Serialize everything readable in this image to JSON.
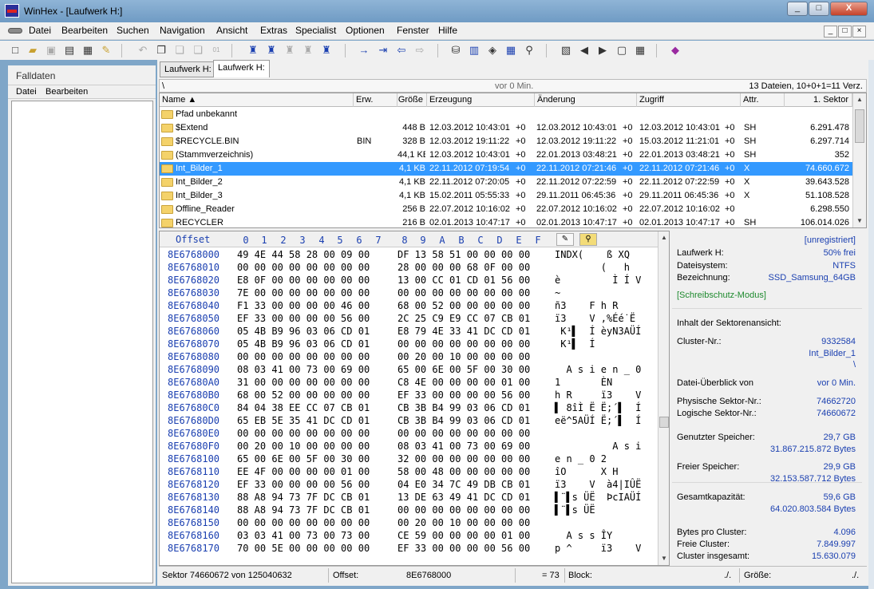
{
  "window": {
    "title": "WinHex - [Laufwerk H:]",
    "caption_buttons": [
      "_",
      "□",
      "X"
    ]
  },
  "menu": {
    "items": [
      "Datei",
      "Bearbeiten",
      "Suchen",
      "Navigation",
      "Ansicht",
      "Extras",
      "Specialist",
      "Optionen",
      "Fenster",
      "Hilfe"
    ],
    "mdi_buttons": [
      "_",
      "□",
      "×"
    ]
  },
  "toolbar": {
    "icons": [
      "new-file-icon",
      "open-icon",
      "save-icon",
      "print-icon",
      "properties-icon",
      "edit-icon",
      "undo-icon",
      "copy-icon",
      "paste-icon",
      "write-icon",
      "find-text-icon",
      "find-hex-icon",
      "replace-text-icon",
      "replace-hex-icon",
      "find-combined-icon",
      "goto-offset-icon",
      "goto-sector-icon",
      "back-icon",
      "forward-icon",
      "open-disk-icon",
      "clone-icon",
      "image-icon",
      "calculator-icon",
      "analyze-icon",
      "directory-browser-icon",
      "prev-icon",
      "next-icon",
      "snapshot-icon",
      "grid-icon",
      "help-book-icon"
    ]
  },
  "case_pane": {
    "title": "Falldaten",
    "menu": [
      "Datei",
      "Bearbeiten"
    ]
  },
  "tabs": [
    "Laufwerk H:",
    "Laufwerk H:"
  ],
  "pathbar": {
    "path": "\\",
    "age": "vor 0 Min.",
    "summary": "13 Dateien, 10+0+1=11 Verz."
  },
  "directory": {
    "columns": [
      "Name ▲",
      "Erw.",
      "Größe",
      "Erzeugung",
      "Änderung",
      "Zugriff",
      "Attr.",
      "1. Sektor"
    ],
    "rows": [
      {
        "name": "Pfad unbekannt",
        "ext": "",
        "size": "",
        "created": "",
        "created_tz": "",
        "modified": "",
        "modified_tz": "",
        "accessed": "",
        "accessed_tz": "",
        "attr": "",
        "sector": "",
        "selected": false
      },
      {
        "name": "$Extend",
        "ext": "",
        "size": "448 B",
        "created": "12.03.2012  10:43:01",
        "created_tz": "+0",
        "modified": "12.03.2012  10:43:01",
        "modified_tz": "+0",
        "accessed": "12.03.2012  10:43:01",
        "accessed_tz": "+0",
        "attr": "SH",
        "sector": "6.291.478",
        "selected": false
      },
      {
        "name": "$RECYCLE.BIN",
        "ext": "BIN",
        "size": "328 B",
        "created": "12.03.2012  19:11:22",
        "created_tz": "+0",
        "modified": "12.03.2012  19:11:22",
        "modified_tz": "+0",
        "accessed": "15.03.2012  11:21:01",
        "accessed_tz": "+0",
        "attr": "SH",
        "sector": "6.297.714",
        "selected": false
      },
      {
        "name": "(Stammverzeichnis)",
        "ext": "",
        "size": "44,1 KB",
        "created": "12.03.2012  10:43:01",
        "created_tz": "+0",
        "modified": "22.01.2013  03:48:21",
        "modified_tz": "+0",
        "accessed": "22.01.2013  03:48:21",
        "accessed_tz": "+0",
        "attr": "SH",
        "sector": "352",
        "selected": false
      },
      {
        "name": "Int_Bilder_1",
        "ext": "",
        "size": "4,1 KB",
        "created": "22.11.2012  07:19:54",
        "created_tz": "+0",
        "modified": "22.11.2012  07:21:46",
        "modified_tz": "+0",
        "accessed": "22.11.2012  07:21:46",
        "accessed_tz": "+0",
        "attr": "X",
        "sector": "74.660.672",
        "selected": true
      },
      {
        "name": "Int_Bilder_2",
        "ext": "",
        "size": "4,1 KB",
        "created": "22.11.2012  07:20:05",
        "created_tz": "+0",
        "modified": "22.11.2012  07:22:59",
        "modified_tz": "+0",
        "accessed": "22.11.2012  07:22:59",
        "accessed_tz": "+0",
        "attr": "X",
        "sector": "39.643.528",
        "selected": false
      },
      {
        "name": "Int_Bilder_3",
        "ext": "",
        "size": "4,1 KB",
        "created": "15.02.2011  05:55:33",
        "created_tz": "+0",
        "modified": "29.11.2011  06:45:36",
        "modified_tz": "+0",
        "accessed": "29.11.2011  06:45:36",
        "accessed_tz": "+0",
        "attr": "X",
        "sector": "51.108.528",
        "selected": false
      },
      {
        "name": "Offline_Reader",
        "ext": "",
        "size": "256 B",
        "created": "22.07.2012  10:16:02",
        "created_tz": "+0",
        "modified": "22.07.2012  10:16:02",
        "modified_tz": "+0",
        "accessed": "22.07.2012  10:16:02",
        "accessed_tz": "+0",
        "attr": "",
        "sector": "6.298.550",
        "selected": false
      },
      {
        "name": "RECYCLER",
        "ext": "",
        "size": "216 B",
        "created": "02.01.2013  10:47:17",
        "created_tz": "+0",
        "modified": "02.01.2013  10:47:17",
        "modified_tz": "+0",
        "accessed": "02.01.2013  10:47:17",
        "accessed_tz": "+0",
        "attr": "SH",
        "sector": "106.014.026",
        "selected": false
      }
    ]
  },
  "hex": {
    "offset_label": "Offset",
    "col_headers": [
      "0",
      "1",
      "2",
      "3",
      "4",
      "5",
      "6",
      "7",
      "8",
      "9",
      "A",
      "B",
      "C",
      "D",
      "E",
      "F"
    ],
    "rows": [
      {
        "off": "8E6768000",
        "b1": "49 4E 44 58 28 00 09 00",
        "b2": "DF 13 58 51 00 00 00 00",
        "asc": "INDX(    ß XQ    "
      },
      {
        "off": "8E6768010",
        "b1": "00 00 00 00 00 00 00 00",
        "b2": "28 00 00 00 68 0F 00 00",
        "asc": "        (   h   "
      },
      {
        "off": "8E6768020",
        "b1": "E8 0F 00 00 00 00 00 00",
        "b2": "13 00 CC 01 CD 01 56 00",
        "asc": "è         Ì Í V "
      },
      {
        "off": "8E6768030",
        "b1": "7E 00 00 00 00 00 00 00",
        "b2": "00 00 00 00 00 00 00 00",
        "asc": "~               "
      },
      {
        "off": "8E6768040",
        "b1": "F1 33 00 00 00 00 46 00",
        "b2": "68 00 52 00 00 00 00 00",
        "asc": "ñ3    F h R     "
      },
      {
        "off": "8E6768050",
        "b1": "EF 33 00 00 00 00 56 00",
        "b2": "2C 25 C9 E9 CC 07 CB 01",
        "asc": "ï3    V ,%Éé̇ Ë "
      },
      {
        "off": "8E6768060",
        "b1": "05 4B B9 96 03 06 CD 01",
        "b2": "E8 79 4E 33 41 DC CD 01",
        "asc": " K¹▌  Í èyN3AÜÍ "
      },
      {
        "off": "8E6768070",
        "b1": "05 4B B9 96 03 06 CD 01",
        "b2": "00 00 00 00 00 00 00 00",
        "asc": " K¹▌  Í         "
      },
      {
        "off": "8E6768080",
        "b1": "00 00 00 00 00 00 00 00",
        "b2": "00 20 00 10 00 00 00 00",
        "asc": "                "
      },
      {
        "off": "8E6768090",
        "b1": "08 03 41 00 73 00 69 00",
        "b2": "65 00 6E 00 5F 00 30 00",
        "asc": "  A s i e n _ 0 "
      },
      {
        "off": "8E67680A0",
        "b1": "31 00 00 00 00 00 00 00",
        "b2": "C8 4E 00 00 00 00 01 00",
        "asc": "1       ÈN      "
      },
      {
        "off": "8E67680B0",
        "b1": "68 00 52 00 00 00 00 00",
        "b2": "EF 33 00 00 00 00 56 00",
        "asc": "h R     ï3    V "
      },
      {
        "off": "8E67680C0",
        "b1": "84 04 38 EE CC 07 CB 01",
        "b2": "CB 3B B4 99 03 06 CD 01",
        "asc": "▌ 8îÌ Ë Ë;´▌  Í "
      },
      {
        "off": "8E67680D0",
        "b1": "65 EB 5E 35 41 DC CD 01",
        "b2": "CB 3B B4 99 03 06 CD 01",
        "asc": "eë^5AÜÍ Ë;´▌  Í "
      },
      {
        "off": "8E67680E0",
        "b1": "00 00 00 00 00 00 00 00",
        "b2": "00 00 00 00 00 00 00 00",
        "asc": "                "
      },
      {
        "off": "8E67680F0",
        "b1": "00 20 00 10 00 00 00 00",
        "b2": "08 03 41 00 73 00 69 00",
        "asc": "          A s i "
      },
      {
        "off": "8E6768100",
        "b1": "65 00 6E 00 5F 00 30 00",
        "b2": "32 00 00 00 00 00 00 00",
        "asc": "e n _ 0 2       "
      },
      {
        "off": "8E6768110",
        "b1": "EE 4F 00 00 00 00 01 00",
        "b2": "58 00 48 00 00 00 00 00",
        "asc": "îO      X H     "
      },
      {
        "off": "8E6768120",
        "b1": "EF 33 00 00 00 00 56 00",
        "b2": "04 E0 34 7C 49 DB CB 01",
        "asc": "ï3    V  à4|IÛË "
      },
      {
        "off": "8E6768130",
        "b1": "88 A8 94 73 7F DC CB 01",
        "b2": "13 DE 63 49 41 DC CD 01",
        "asc": "▌¨▌s ÜË  ÞcIAÜÍ "
      },
      {
        "off": "8E6768140",
        "b1": "88 A8 94 73 7F DC CB 01",
        "b2": "00 00 00 00 00 00 00 00",
        "asc": "▌¨▌s ÜË         "
      },
      {
        "off": "8E6768150",
        "b1": "00 00 00 00 00 00 00 00",
        "b2": "00 20 00 10 00 00 00 00",
        "asc": "                "
      },
      {
        "off": "8E6768160",
        "b1": "03 03 41 00 73 00 73 00",
        "b2": "CE 59 00 00 00 00 01 00",
        "asc": "  A s s ÎY      "
      },
      {
        "off": "8E6768170",
        "b1": "70 00 5E 00 00 00 00 00",
        "b2": "EF 33 00 00 00 00 56 00",
        "asc": "p ^     ï3    V "
      }
    ]
  },
  "info": {
    "unregistered": "[unregistriert]",
    "drive_label": "Laufwerk H:",
    "drive_free": "50% frei",
    "fs_label": "Dateisystem:",
    "fs_value": "NTFS",
    "name_label": "Bezeichnung:",
    "name_value": "SSD_Samsung_64GB",
    "write_protect": "[Schreibschutz-Modus]",
    "sector_view_title": "Inhalt der Sektorenansicht:",
    "cluster_label": "Cluster-Nr.:",
    "cluster_value": "9332584",
    "cluster_folder": "Int_Bilder_1",
    "cluster_path": "\\",
    "overview_label": "Datei-Überblick von",
    "overview_value": "vor 0 Min.",
    "phys_label": "Physische Sektor-Nr.:",
    "phys_value": "74662720",
    "log_label": "Logische Sektor-Nr.:",
    "log_value": "74660672",
    "used_label": "Genutzter Speicher:",
    "used_gb": "29,7 GB",
    "used_bytes": "31.867.215.872 Bytes",
    "free_label": "Freier Speicher:",
    "free_gb": "29,9 GB",
    "free_bytes": "32.153.587.712 Bytes",
    "total_label": "Gesamtkapazität:",
    "total_gb": "59,6 GB",
    "total_bytes": "64.020.803.584 Bytes",
    "bpc_label": "Bytes pro Cluster:",
    "bpc_value": "4.096",
    "freec_label": "Freie Cluster:",
    "freec_value": "7.849.997",
    "totalc_label": "Cluster insgesamt:",
    "totalc_value": "15.630.079"
  },
  "status": {
    "sector": "Sektor 74660672 von 125040632",
    "offset_label": "Offset:",
    "offset_value": "8E6768000",
    "value": "= 73",
    "block_label": "Block:",
    "block_value": "./.",
    "size_label": "Größe:",
    "size_value": "./."
  }
}
